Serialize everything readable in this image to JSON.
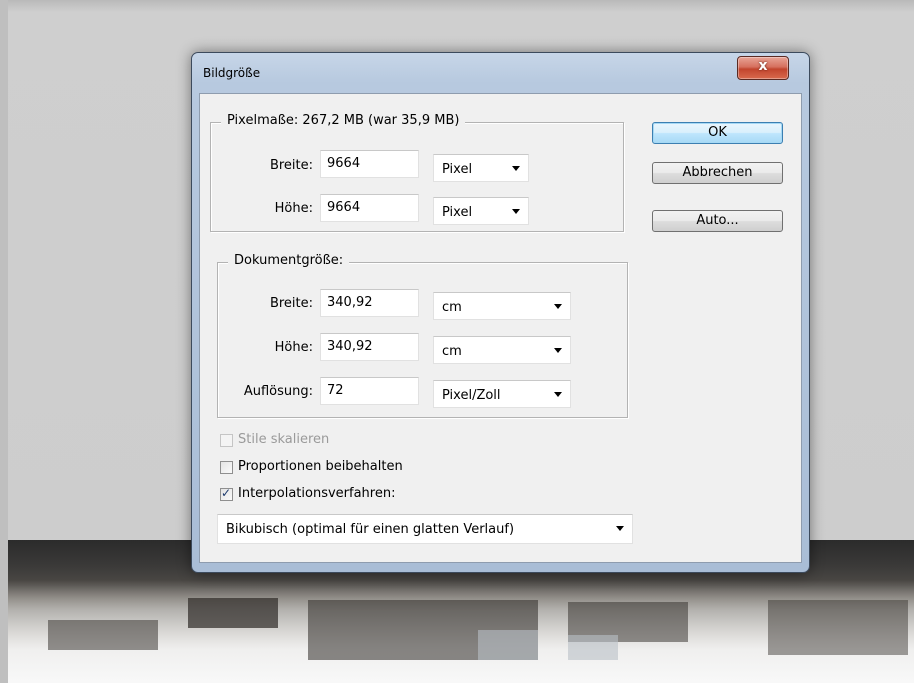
{
  "dialog": {
    "title": "Bildgröße",
    "close_glyph": "x",
    "pixel_dimensions": {
      "legend": "Pixelmaße: 267,2 MB (war 35,9 MB)",
      "width_label": "Breite:",
      "width_value": "9664",
      "width_unit": "Pixel",
      "height_label": "Höhe:",
      "height_value": "9664",
      "height_unit": "Pixel"
    },
    "document_size": {
      "legend": "Dokumentgröße:",
      "width_label": "Breite:",
      "width_value": "340,92",
      "width_unit": "cm",
      "height_label": "Höhe:",
      "height_value": "340,92",
      "height_unit": "cm",
      "resolution_label": "Auflösung:",
      "resolution_value": "72",
      "resolution_unit": "Pixel/Zoll"
    },
    "options": {
      "scale_styles": {
        "label": "Stile skalieren",
        "checked": false,
        "disabled": true
      },
      "constrain_proportions": {
        "label": "Proportionen beibehalten",
        "checked": false,
        "disabled": false
      },
      "resample": {
        "label": "Interpolationsverfahren:",
        "checked": true,
        "disabled": false
      },
      "resample_method": "Bikubisch (optimal für einen glatten Verlauf)"
    },
    "buttons": {
      "ok": "OK",
      "cancel": "Abbrechen",
      "auto": "Auto..."
    }
  }
}
